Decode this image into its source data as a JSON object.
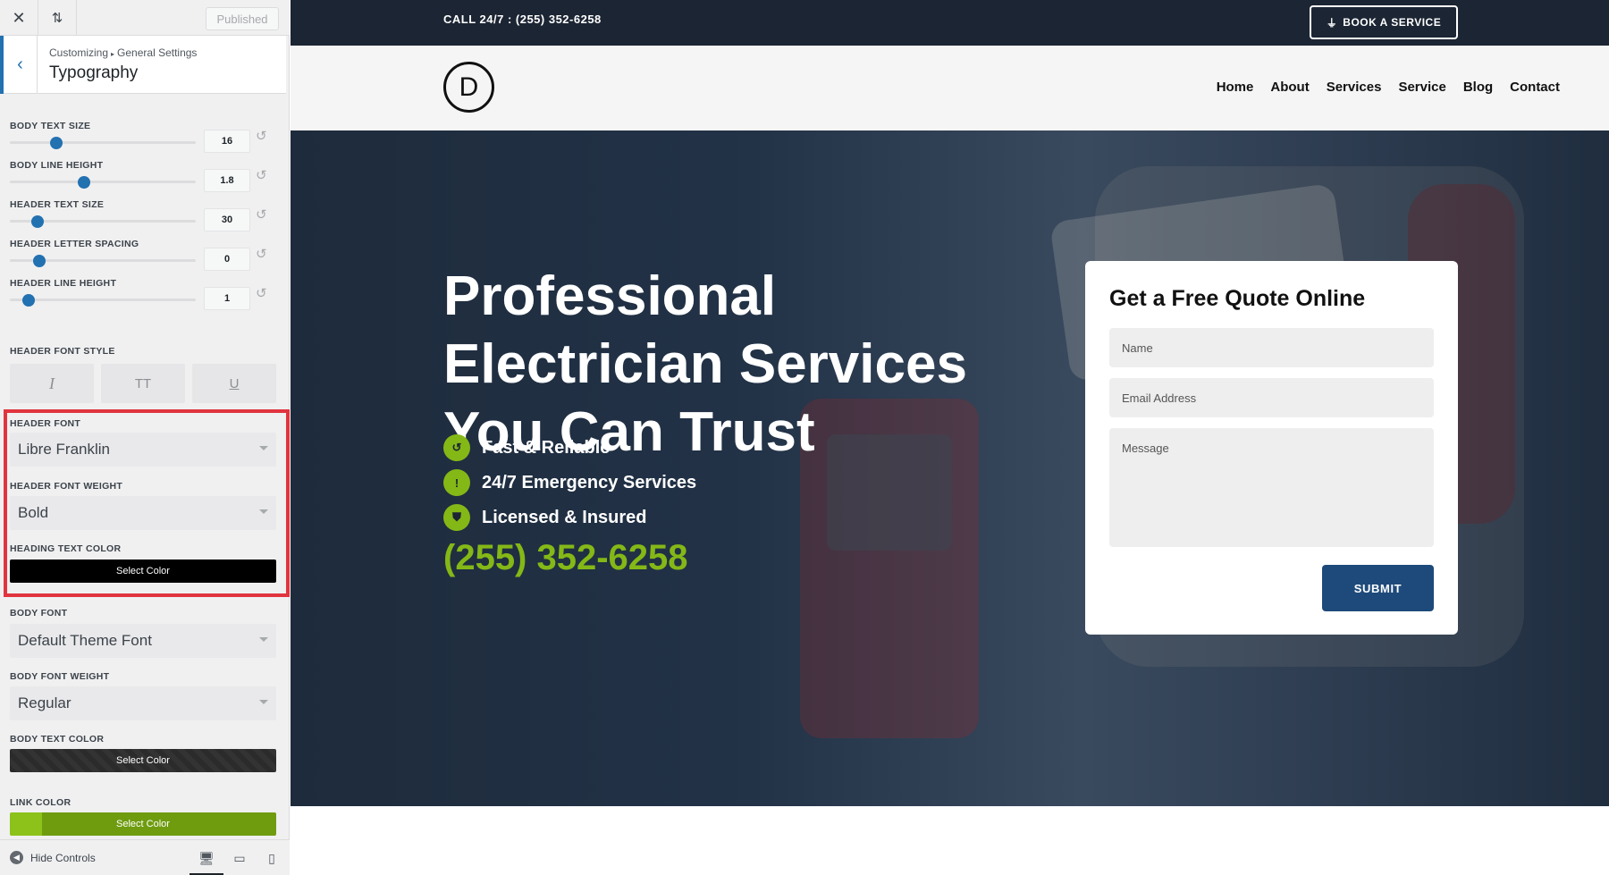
{
  "panel": {
    "published_label": "Published",
    "breadcrumb": {
      "root": "Customizing",
      "sep": "▸",
      "parent": "General Settings"
    },
    "section_title": "Typography",
    "sliders": [
      {
        "label": "BODY TEXT SIZE",
        "value": "16",
        "fraction": 0.25
      },
      {
        "label": "BODY LINE HEIGHT",
        "value": "1.8",
        "fraction": 0.4
      },
      {
        "label": "HEADER TEXT SIZE",
        "value": "30",
        "fraction": 0.15
      },
      {
        "label": "HEADER LETTER SPACING",
        "value": "0",
        "fraction": 0.16
      },
      {
        "label": "HEADER LINE HEIGHT",
        "value": "1",
        "fraction": 0.1
      }
    ],
    "header_font_style": {
      "label": "HEADER FONT STYLE",
      "italic": "I",
      "uppercase": "TT",
      "underline": "U"
    },
    "header_font": {
      "label": "HEADER FONT",
      "value": "Libre Franklin"
    },
    "header_font_weight": {
      "label": "HEADER FONT WEIGHT",
      "value": "Bold"
    },
    "heading_text_color": {
      "label": "HEADING TEXT COLOR",
      "button": "Select Color",
      "color": "#000000"
    },
    "body_font": {
      "label": "BODY FONT",
      "value": "Default Theme Font"
    },
    "body_font_weight": {
      "label": "BODY FONT WEIGHT",
      "value": "Regular"
    },
    "body_text_color": {
      "label": "BODY TEXT COLOR",
      "button": "Select Color",
      "color": "#2b2b2b"
    },
    "link_color": {
      "label": "LINK COLOR",
      "button": "Select Color",
      "color": "#7cac14"
    },
    "footer": {
      "hide_controls": "Hide Controls"
    }
  },
  "site": {
    "topbar": {
      "call_text": "CALL 24/7 : (255) 352-6258",
      "book_button": "BOOK A SERVICE"
    },
    "logo_letter": "D",
    "nav": [
      "Home",
      "About",
      "Services",
      "Service",
      "Blog",
      "Contact"
    ],
    "hero": {
      "title_lines": [
        "Professional",
        "Electrician Services",
        "You Can Trust"
      ],
      "features": [
        "Fast & Reliable",
        "24/7 Emergency Services",
        "Licensed & Insured"
      ],
      "phone": "(255) 352-6258"
    },
    "quote_form": {
      "title": "Get a Free Quote Online",
      "name_placeholder": "Name",
      "email_placeholder": "Email Address",
      "message_placeholder": "Message",
      "submit": "SUBMIT"
    }
  },
  "colors": {
    "accent_green": "#84b817",
    "dark_navy": "#1c2533",
    "submit_blue": "#1d4a7a",
    "highlight_red": "#e0343f",
    "wp_blue": "#2271b1"
  }
}
